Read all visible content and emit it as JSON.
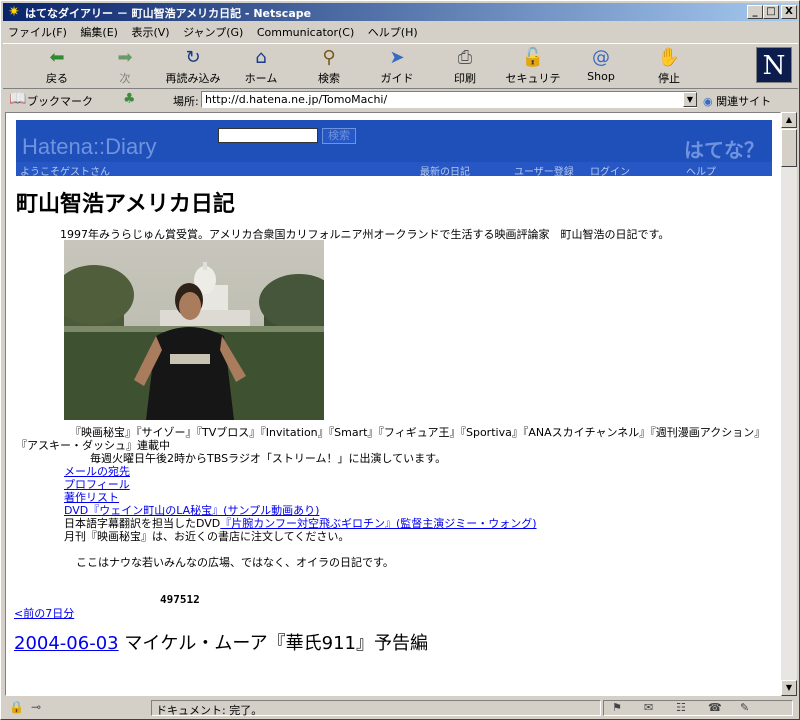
{
  "window": {
    "title": "はてなダイアリー － 町山智浩アメリカ日記 - Netscape",
    "app_icon": "netscape-star-icon",
    "controls": [
      "_",
      "□",
      "X"
    ]
  },
  "menu": [
    "ファイル(F)",
    "編集(E)",
    "表示(V)",
    "ジャンプ(G)",
    "Communicator(C)",
    "ヘルプ(H)"
  ],
  "toolbar": {
    "buttons": [
      {
        "label": "戻る",
        "icon": "back-arrow-icon",
        "glyph": "⬅"
      },
      {
        "label": "次",
        "icon": "forward-arrow-icon",
        "glyph": "➡"
      },
      {
        "label": "再読み込み",
        "icon": "reload-icon",
        "glyph": "↻"
      },
      {
        "label": "ホーム",
        "icon": "home-icon",
        "glyph": "⌂"
      },
      {
        "label": "検索",
        "icon": "search-icon",
        "glyph": "⚲"
      },
      {
        "label": "ガイド",
        "icon": "guide-icon",
        "glyph": "➤"
      },
      {
        "label": "印刷",
        "icon": "print-icon",
        "glyph": "⎙"
      },
      {
        "label": "セキュリティ",
        "icon": "lock-icon",
        "glyph": "🔓"
      },
      {
        "label": "Shop",
        "icon": "shop-icon",
        "glyph": "@"
      },
      {
        "label": "停止",
        "icon": "stop-icon",
        "glyph": "✋"
      }
    ],
    "logo": "N"
  },
  "location": {
    "bookmarks_label": "ブックマーク",
    "location_label": "場所:",
    "url": "http://d.hatena.ne.jp/TomoMachi/",
    "related_label": "関連サイト"
  },
  "hatena": {
    "logo": "Hatena::Diary",
    "search_button": "検索",
    "hatenaq": "はてな？",
    "nav": {
      "welcome": "ようこそゲストさん",
      "latest": "最新の日記",
      "register": "ユーザー登録",
      "login": "ログイン",
      "help": "ヘルプ"
    }
  },
  "page": {
    "title": "町山智浩アメリカ日記",
    "description": "1997年みうらじゅん賞受賞。アメリカ合衆国カリフォルニア州オークランドで生活する映画評論家　町山智浩の日記です。",
    "serial_line1": "『映画秘宝』『サイゾー』『TVブロス』『Invitation』『Smart』『フィギュア王』『Sportiva』『ANAスカイチャンネル』『週刊漫画アクション』",
    "serial_line2": "『アスキー・ダッシュ』連載中",
    "radio": "毎週火曜日午後2時からTBSラジオ「ストリーム！」に出演しています。",
    "links": {
      "mail": "メールの宛先",
      "profile": "プロフィール",
      "works": "著作リスト",
      "dvd": "DVD『ウェイン町山のLA秘宝』(サンプル動画あり)"
    },
    "subtitle_prefix": "日本語字幕翻訳を担当したDVD",
    "subtitle_link": "『片腕カンフー対空飛ぶギロチン』(監督主演ジミー・ウォング)",
    "monthly": "月刊『映画秘宝』は、お近くの書店に注文してください。",
    "plaza": "ここはナウな若いみんなの広場、ではなく、オイラの日記です。",
    "counter": "497512",
    "prev_week": "<前の7日分",
    "entry_date": "2004-06-03",
    "entry_title": "マイケル・ムーア『華氏911』予告編"
  },
  "status": {
    "text": "ドキュメント: 完了。"
  }
}
